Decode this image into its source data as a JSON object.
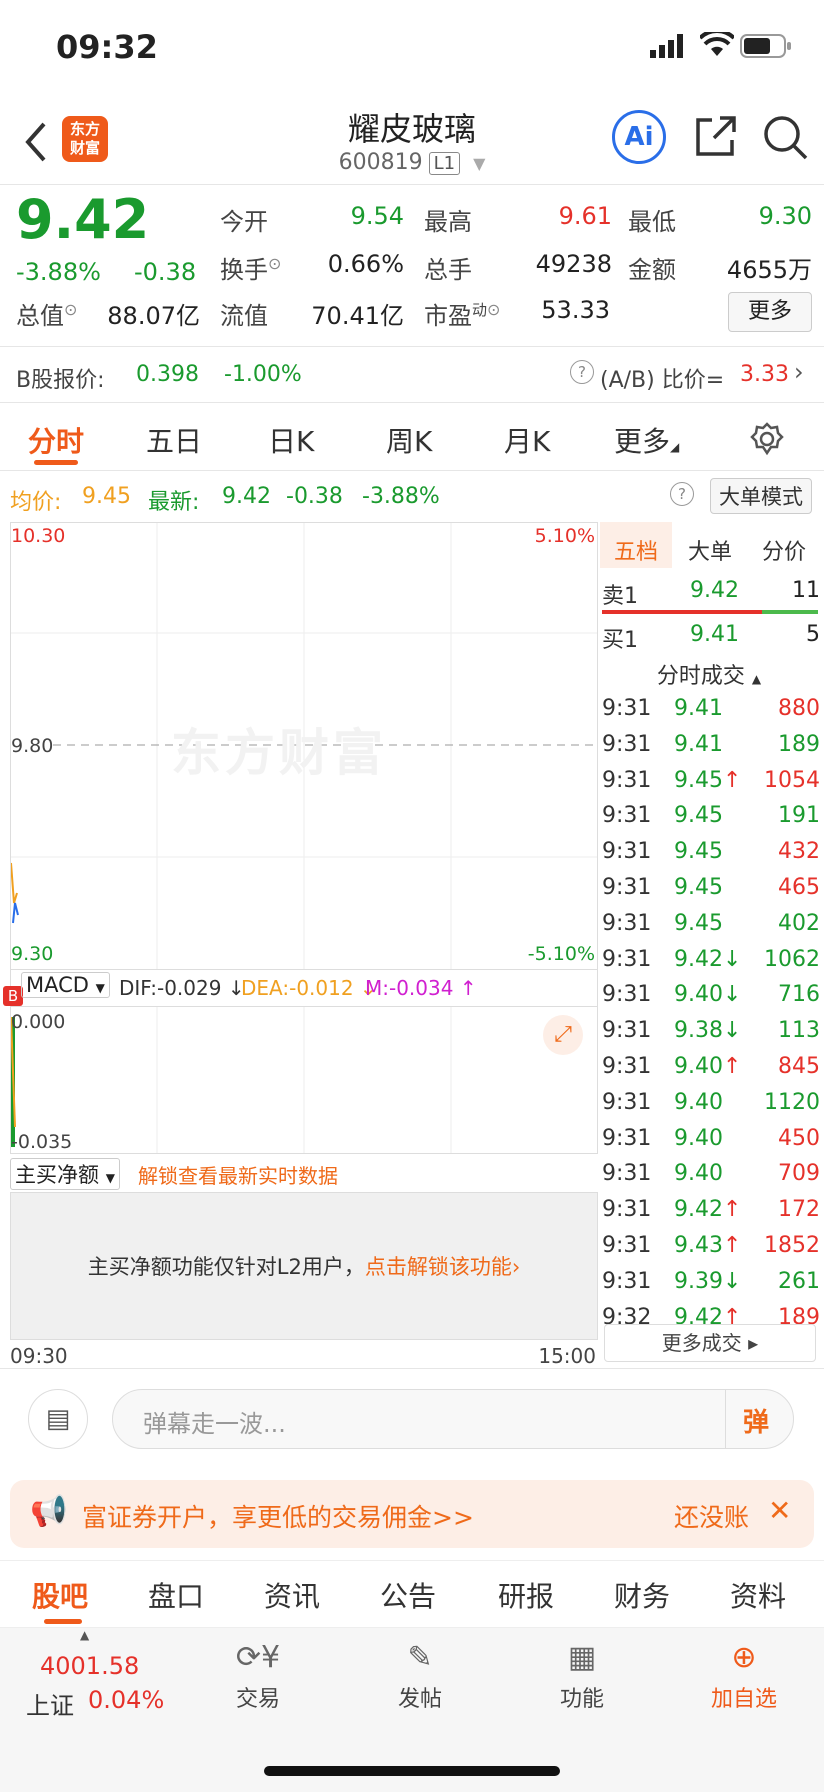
{
  "status": {
    "time": "09:32"
  },
  "header": {
    "title": "耀皮玻璃",
    "code": "600819",
    "level": "L1",
    "ai_label": "Ai",
    "logo_text": "东方\n财富"
  },
  "quote": {
    "price": "9.42",
    "change_pct": "-3.88%",
    "change": "-0.38",
    "open_label": "今开",
    "open": "9.54",
    "high_label": "最高",
    "high": "9.61",
    "low_label": "最低",
    "low": "9.30",
    "turnover_label": "换手",
    "turnover": "0.66%",
    "volume_label": "总手",
    "volume": "49238",
    "amount_label": "金额",
    "amount": "4655万",
    "mcap_label": "总值",
    "mcap": "88.07亿",
    "float_label": "流值",
    "float": "70.41亿",
    "pe_label": "市盈",
    "pe_sup": "动",
    "pe": "53.33",
    "more_label": "更多"
  },
  "bshare": {
    "label": "B股报价:",
    "price": "0.398",
    "pct": "-1.00%",
    "ratio_label": "(A/B) 比价=",
    "ratio": "3.33"
  },
  "tabs": [
    "分时",
    "五日",
    "日K",
    "周K",
    "月K",
    "更多"
  ],
  "avgline": {
    "avg_label": "均价:",
    "avg": "9.45",
    "latest_label": "最新:",
    "latest": "9.42",
    "chg": "-0.38",
    "pct": "-3.88%",
    "big_order_label": "大单模式"
  },
  "chart": {
    "y_top": "10.30",
    "y_mid": "9.80",
    "y_bot": "9.30",
    "pct_top": "5.10%",
    "pct_bot": "-5.10%",
    "watermark": "东方财富",
    "x_start": "09:30",
    "x_end": "15:00"
  },
  "macd": {
    "label": "MACD",
    "dif": "DIF:-0.029 ↓",
    "dea": "DEA:-0.012 ↓",
    "m": "M:-0.034 ↑",
    "y_top": "0.000",
    "y_bot": "-0.035",
    "marker": "B"
  },
  "net": {
    "label": "主买净额",
    "unlock_link": "解锁查看最新实时数据",
    "msg": "主买净额功能仅针对L2用户，",
    "msg_link": "点击解锁该功能"
  },
  "rpanel": {
    "tabs": [
      "五档",
      "大单",
      "分价"
    ],
    "sell1": {
      "label": "卖1",
      "price": "9.42",
      "vol": "11"
    },
    "buy1": {
      "label": "买1",
      "price": "9.41",
      "vol": "5"
    },
    "trades_title": "分时成交",
    "trades": [
      {
        "t": "9:31",
        "p": "9.41",
        "a": "",
        "v": "880",
        "c": "red"
      },
      {
        "t": "9:31",
        "p": "9.41",
        "a": "",
        "v": "189",
        "c": "green"
      },
      {
        "t": "9:31",
        "p": "9.45",
        "a": "↑",
        "v": "1054",
        "c": "red"
      },
      {
        "t": "9:31",
        "p": "9.45",
        "a": "",
        "v": "191",
        "c": "green"
      },
      {
        "t": "9:31",
        "p": "9.45",
        "a": "",
        "v": "432",
        "c": "red"
      },
      {
        "t": "9:31",
        "p": "9.45",
        "a": "",
        "v": "465",
        "c": "red"
      },
      {
        "t": "9:31",
        "p": "9.45",
        "a": "",
        "v": "402",
        "c": "green"
      },
      {
        "t": "9:31",
        "p": "9.42",
        "a": "↓",
        "v": "1062",
        "c": "green"
      },
      {
        "t": "9:31",
        "p": "9.40",
        "a": "↓",
        "v": "716",
        "c": "green"
      },
      {
        "t": "9:31",
        "p": "9.38",
        "a": "↓",
        "v": "113",
        "c": "green"
      },
      {
        "t": "9:31",
        "p": "9.40",
        "a": "↑",
        "v": "845",
        "c": "red"
      },
      {
        "t": "9:31",
        "p": "9.40",
        "a": "",
        "v": "1120",
        "c": "green"
      },
      {
        "t": "9:31",
        "p": "9.40",
        "a": "",
        "v": "450",
        "c": "red"
      },
      {
        "t": "9:31",
        "p": "9.40",
        "a": "",
        "v": "709",
        "c": "red"
      },
      {
        "t": "9:31",
        "p": "9.42",
        "a": "↑",
        "v": "172",
        "c": "red"
      },
      {
        "t": "9:31",
        "p": "9.43",
        "a": "↑",
        "v": "1852",
        "c": "red"
      },
      {
        "t": "9:31",
        "p": "9.39",
        "a": "↓",
        "v": "261",
        "c": "green"
      },
      {
        "t": "9:32",
        "p": "9.42",
        "a": "↑",
        "v": "189",
        "c": "red"
      }
    ],
    "more_trades": "更多成交"
  },
  "comment": {
    "placeholder": "弹幕走一波...",
    "send": "弹"
  },
  "promo": {
    "text": "富证券开户，享更低的交易佣金>>",
    "right": "还没账"
  },
  "bottom_tabs": [
    "股吧",
    "盘口",
    "资讯",
    "公告",
    "研报",
    "财务",
    "资料"
  ],
  "toolbar": {
    "index_value": "4001.58",
    "index_name": "上证",
    "index_pct": "0.04%",
    "trade": "交易",
    "post": "发帖",
    "func": "功能",
    "add": "加自选"
  },
  "colors": {
    "up": "#e5312a",
    "down": "#1a9a2e",
    "accent": "#ef6a1a"
  }
}
